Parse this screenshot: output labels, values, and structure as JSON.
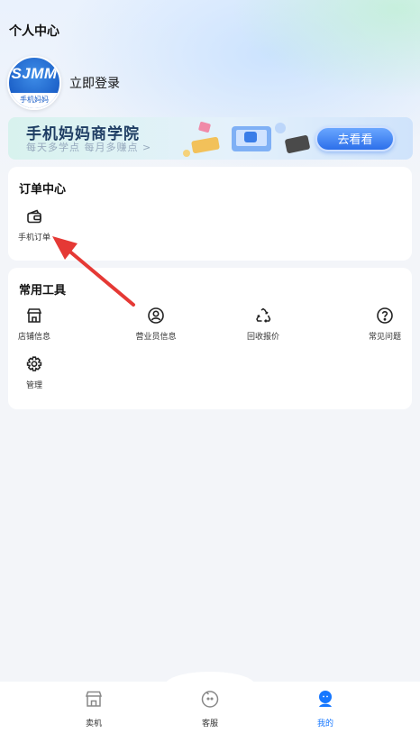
{
  "header": {
    "title": "个人中心"
  },
  "profile": {
    "avatar_top": "SJMM",
    "avatar_bottom": "手机妈妈",
    "login_label": "立即登录"
  },
  "banner": {
    "title": "手机妈妈商学院",
    "subtitle": "每天多学点 每月多赚点 >",
    "button_label": "去看看"
  },
  "order_center": {
    "title": "订单中心",
    "items": [
      {
        "label": "手机订单",
        "icon": "wallet-icon"
      }
    ]
  },
  "tools": {
    "title": "常用工具",
    "items": [
      {
        "label": "店铺信息",
        "icon": "store-icon"
      },
      {
        "label": "营业员信息",
        "icon": "user-circle-icon"
      },
      {
        "label": "回收报价",
        "icon": "recycle-icon"
      },
      {
        "label": "常见问题",
        "icon": "question-icon"
      },
      {
        "label": "管理",
        "icon": "gear-icon"
      }
    ]
  },
  "tabbar": {
    "items": [
      {
        "label": "卖机",
        "icon": "store-icon"
      },
      {
        "label": "客服",
        "icon": "service-face-icon"
      },
      {
        "label": "我的",
        "icon": "profile-icon",
        "active": true
      }
    ],
    "active_color": "#1677ff"
  },
  "annotation": {
    "arrow_color": "#e53935"
  }
}
